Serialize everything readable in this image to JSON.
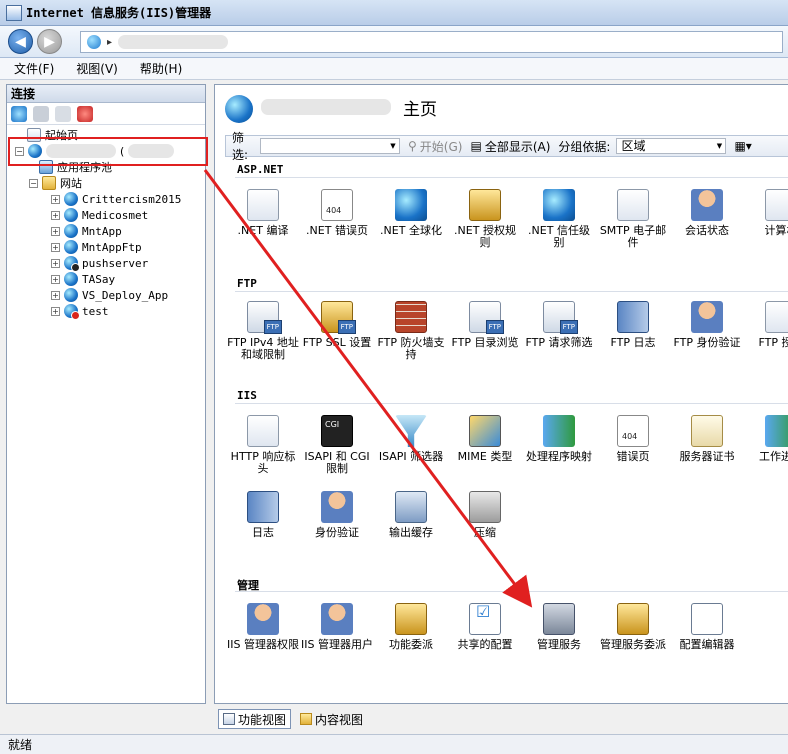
{
  "window": {
    "title": "Internet 信息服务(IIS)管理器"
  },
  "menu": [
    "文件(F)",
    "视图(V)",
    "帮助(H)"
  ],
  "left": {
    "header": "连接",
    "tree": {
      "start_page": "起始页",
      "server_suffix": "(",
      "app_pools": "应用程序池",
      "sites": "网站",
      "site_list": [
        {
          "name": "Crittercism2015",
          "state": "running"
        },
        {
          "name": "Medicosmet",
          "state": "running"
        },
        {
          "name": "MntApp",
          "state": "running"
        },
        {
          "name": "MntAppFtp",
          "state": "running"
        },
        {
          "name": "pushserver",
          "state": "black"
        },
        {
          "name": "TASay",
          "state": "running"
        },
        {
          "name": "VS_Deploy_App",
          "state": "running"
        },
        {
          "name": "test",
          "state": "stopped"
        }
      ]
    }
  },
  "main": {
    "title_suffix": "主页",
    "filter": {
      "label": "筛选:",
      "start": "开始(G)",
      "show_all": "全部显示(A)",
      "group_by": "分组依据:",
      "group_value": "区域"
    },
    "sections": {
      "aspnet": {
        "title": "ASP.NET",
        "items": [
          ".NET 编译",
          ".NET 错误页",
          ".NET 全球化",
          ".NET 授权规则",
          ".NET 信任级别",
          "SMTP 电子邮件",
          "会话状态",
          "计算机"
        ]
      },
      "ftp": {
        "title": "FTP",
        "items": [
          "FTP IPv4 地址和域限制",
          "FTP SSL 设置",
          "FTP 防火墙支持",
          "FTP 目录浏览",
          "FTP 请求筛选",
          "FTP 日志",
          "FTP 身份验证",
          "FTP 授权"
        ]
      },
      "iis": {
        "title": "IIS",
        "items": [
          "HTTP 响应标头",
          "ISAPI 和 CGI 限制",
          "ISAPI 筛选器",
          "MIME 类型",
          "处理程序映射",
          "错误页",
          "服务器证书",
          "工作进程"
        ],
        "items_row2": [
          "日志",
          "身份验证",
          "输出缓存",
          "压缩"
        ]
      },
      "manage": {
        "title": "管理",
        "items": [
          "IIS 管理器权限",
          "IIS 管理器用户",
          "功能委派",
          "共享的配置",
          "管理服务",
          "管理服务委派",
          "配置编辑器"
        ]
      }
    }
  },
  "bottom_tabs": [
    "功能视图",
    "内容视图"
  ],
  "status": "就绪",
  "colors": {
    "highlight": "#e02020",
    "arrow": "#e02020"
  }
}
